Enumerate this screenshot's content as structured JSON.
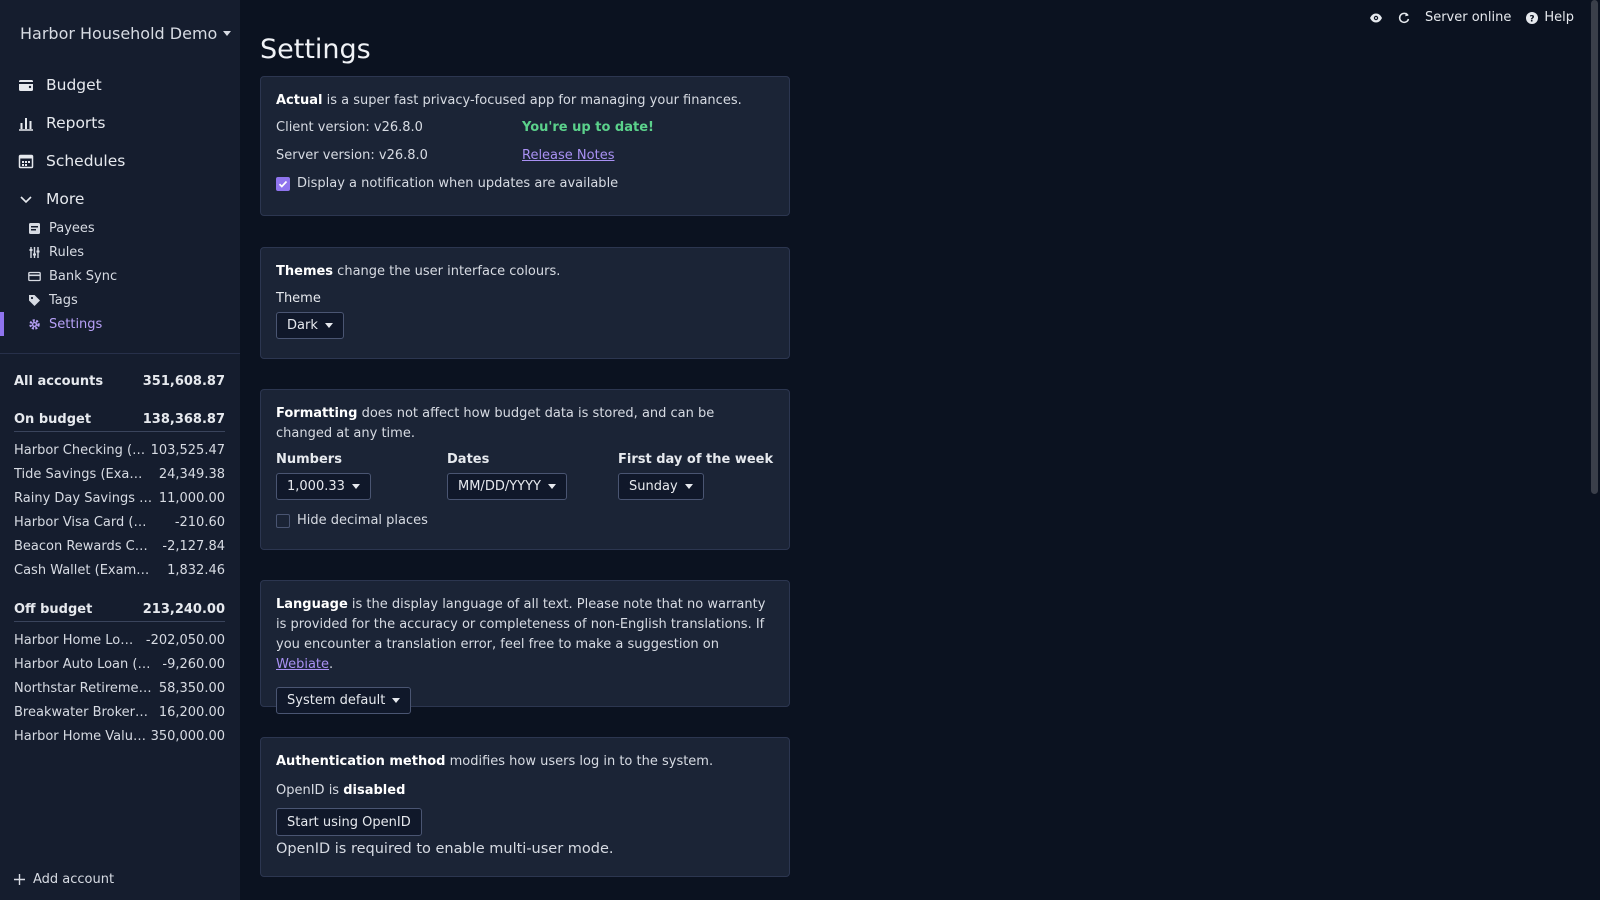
{
  "sidebar": {
    "budget_name": "Harbor Household Demo",
    "nav": [
      {
        "label": "Budget",
        "icon": "wallet-icon"
      },
      {
        "label": "Reports",
        "icon": "bar-chart-icon"
      },
      {
        "label": "Schedules",
        "icon": "calendar-icon"
      },
      {
        "label": "More",
        "icon": "chevron-down-icon"
      }
    ],
    "sub_nav": [
      {
        "label": "Payees",
        "icon": "payees-icon"
      },
      {
        "label": "Rules",
        "icon": "rules-icon"
      },
      {
        "label": "Bank Sync",
        "icon": "card-icon"
      },
      {
        "label": "Tags",
        "icon": "tag-icon"
      },
      {
        "label": "Settings",
        "icon": "gear-icon",
        "active": true
      }
    ],
    "all_accounts": {
      "label": "All accounts",
      "value": "351,608.87"
    },
    "on_budget": {
      "label": "On budget",
      "value": "138,368.87",
      "accounts": [
        {
          "name": "Harbor Checking (…",
          "value": "103,525.47"
        },
        {
          "name": "Tide Savings (Exam…",
          "value": "24,349.38"
        },
        {
          "name": "Rainy Day Savings (…",
          "value": "11,000.00"
        },
        {
          "name": "Harbor Visa Card (Ex…",
          "value": "-210.60"
        },
        {
          "name": "Beacon Rewards Ca…",
          "value": "-2,127.84"
        },
        {
          "name": "Cash Wallet (Example)",
          "value": "1,832.46"
        }
      ]
    },
    "off_budget": {
      "label": "Off budget",
      "value": "213,240.00",
      "accounts": [
        {
          "name": "Harbor Home Lo…",
          "value": "-202,050.00"
        },
        {
          "name": "Harbor Auto Loan (…",
          "value": "-9,260.00"
        },
        {
          "name": "Northstar Retiremen…",
          "value": "58,350.00"
        },
        {
          "name": "Breakwater Brokera…",
          "value": "16,200.00"
        },
        {
          "name": "Harbor Home Valu…",
          "value": "350,000.00"
        }
      ]
    },
    "add_account": "Add account"
  },
  "topbar": {
    "server_status": "Server online",
    "help": "Help"
  },
  "main": {
    "title": "Settings",
    "about": {
      "app_name": "Actual",
      "description": " is a super fast privacy-focused app for managing your finances.",
      "client_version": "Client version: v26.8.0",
      "up_to_date": "You're up to date!",
      "server_version": "Server version: v26.8.0",
      "release_notes": "Release Notes",
      "notify_label": "Display a notification when updates are available",
      "notify_checked": true
    },
    "themes": {
      "heading": "Themes",
      "description": " change the user interface colours.",
      "theme_label": "Theme",
      "theme_value": "Dark"
    },
    "formatting": {
      "heading": "Formatting",
      "description": " does not affect how budget data is stored, and can be changed at any time.",
      "numbers_label": "Numbers",
      "numbers_value": "1,000.33",
      "dates_label": "Dates",
      "dates_value": "MM/DD/YYYY",
      "week_label": "First day of the week",
      "week_value": "Sunday",
      "hide_decimal_label": "Hide decimal places",
      "hide_decimal_checked": false
    },
    "language": {
      "heading": "Language",
      "description": " is the display language of all text. Please note that no warranty is provided for the accuracy or completeness of non-English translations. If you encounter a translation error, feel free to make a suggestion on ",
      "link": "Webiate",
      "trailing": ".",
      "value": "System default"
    },
    "auth": {
      "heading": "Authentication method",
      "description": " modifies how users log in to the system.",
      "openid_prefix": "OpenID is ",
      "openid_status": "disabled",
      "button": "Start using OpenID",
      "note": "OpenID is required to enable multi-user mode."
    }
  },
  "colors": {
    "accent": "#8f74ee",
    "success": "#5bd18b",
    "background": "#0b1220",
    "sidebar": "#151d2e",
    "card": "#1b2436"
  }
}
